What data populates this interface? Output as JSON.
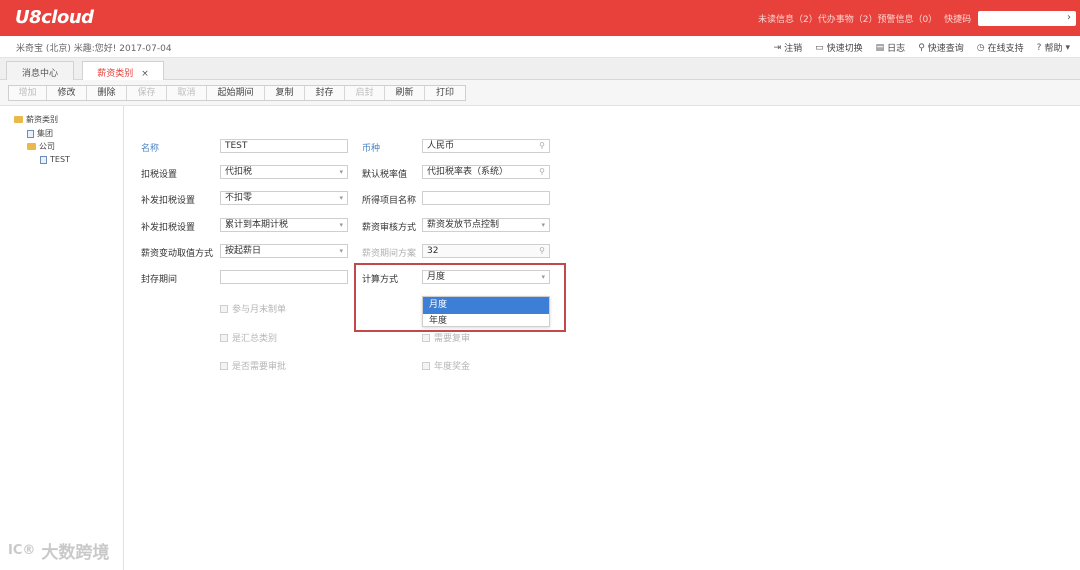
{
  "header": {
    "logo": "U8cloud",
    "messages": "未读信息（2）代办事物（2）预警信息（0）",
    "search_label": "快捷码",
    "accent": "#e8403a"
  },
  "userbar": {
    "info": "米奇宝 (北京) 米趣:您好! 2017-07-04",
    "actions": [
      {
        "icon": "logout-icon",
        "label": "注销"
      },
      {
        "icon": "switch-icon",
        "label": "快速切换"
      },
      {
        "icon": "log-icon",
        "label": "日志"
      },
      {
        "icon": "query-icon",
        "label": "快速查询"
      },
      {
        "icon": "support-icon",
        "label": "在线支持"
      },
      {
        "icon": "help-icon",
        "label": "帮助"
      }
    ]
  },
  "tabs": [
    {
      "label": "消息中心",
      "active": false
    },
    {
      "label": "薪资类别",
      "active": true,
      "close": "×"
    }
  ],
  "toolbar": {
    "buttons": [
      {
        "label": "增加",
        "enabled": false
      },
      {
        "label": "修改",
        "enabled": true
      },
      {
        "label": "删除",
        "enabled": true
      },
      {
        "label": "保存",
        "enabled": false
      },
      {
        "label": "取消",
        "enabled": false
      },
      {
        "label": "起始期间",
        "enabled": true
      },
      {
        "label": "复制",
        "enabled": true
      },
      {
        "label": "封存",
        "enabled": true
      },
      {
        "label": "启封",
        "enabled": false
      },
      {
        "label": "刷新",
        "enabled": true
      },
      {
        "label": "打印",
        "enabled": true
      }
    ]
  },
  "tree": {
    "root": "薪资类别",
    "group": "集团",
    "company": "公司",
    "leaf": "TEST"
  },
  "form": {
    "name_label": "名称",
    "name_value": "TEST",
    "currency_label": "币种",
    "currency_value": "人民币",
    "tax_setting_label": "扣税设置",
    "tax_setting_value": "代扣税",
    "tax_rate_label": "默认税率值",
    "tax_rate_value": "代扣税率表（系统）",
    "supp_tax_label": "补发扣税设置",
    "supp_tax_value": "不扣零",
    "income_item_label": "所得项目名称",
    "income_item_value": "",
    "supp_tax2_label": "补发扣税设置",
    "supp_tax2_value": "累计到本期计税",
    "audit_label": "薪资审核方式",
    "audit_value": "薪资发放节点控制",
    "change_label": "薪资变动取值方式",
    "change_value": "按起薪日",
    "period_scheme_label": "薪资期间方案",
    "period_scheme_value": "32",
    "seal_label": "封存期间",
    "seal_value": "",
    "calc_label": "计算方式",
    "calc_value": "月度",
    "checkboxes": {
      "month_end": "参与月末制单",
      "summary": "是汇总类别",
      "need_approval": "是否需要审批",
      "need_review": "需要复审",
      "annual_bonus": "年度奖金"
    }
  },
  "calc_dropdown": {
    "options": [
      "月度",
      "年度"
    ],
    "selected": "月度"
  },
  "watermark": {
    "logo": "IC®",
    "text": "大数跨境"
  }
}
